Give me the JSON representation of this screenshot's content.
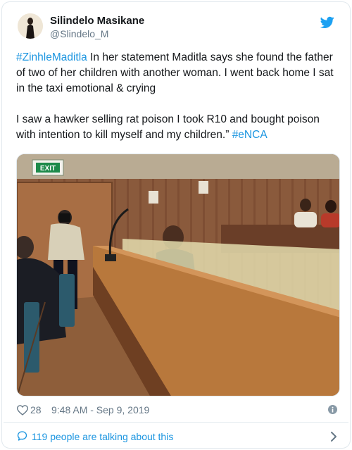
{
  "author": {
    "name": "Silindelo Masikane",
    "handle": "@Slindelo_M"
  },
  "tweet": {
    "hashtag_1": "#ZinhleMaditla",
    "line_1": " In her statement Maditla says she found the father of two of her children with another woman. I went back home I sat in the taxi emotional & crying",
    "line_2": "I saw a hawker selling rat poison I took R10 and bought poison with intention to kill myself and my children.” ",
    "hashtag_2": "#eNCA"
  },
  "media": {
    "exit_sign": "EXIT"
  },
  "meta": {
    "likes": "28",
    "timestamp": "9:48 AM - Sep 9, 2019"
  },
  "footer": {
    "talking": "119 people are talking about this"
  },
  "icons": {
    "brand": "twitter-bird-icon",
    "like": "heart-icon",
    "info": "info-icon",
    "talk": "comment-icon",
    "more": "chevron-right-icon"
  },
  "colors": {
    "link": "#1b95e0",
    "muted": "#657786",
    "border": "#e1e8ed",
    "twitter_blue": "#1da1f2"
  }
}
